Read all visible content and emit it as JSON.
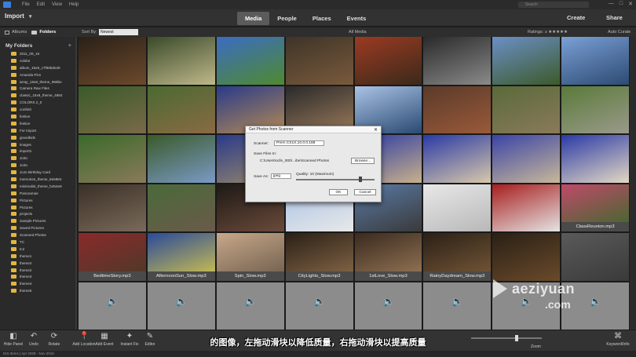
{
  "menu": [
    "File",
    "Edit",
    "View",
    "Help"
  ],
  "search_placeholder": "Search",
  "window_buttons": [
    "—",
    "□",
    "✕"
  ],
  "topbar": {
    "import": "Import",
    "tabs": [
      "Media",
      "People",
      "Places",
      "Events"
    ],
    "active_tab": "Media",
    "create": "Create",
    "share": "Share"
  },
  "view_toggle": {
    "albums": "Albums",
    "folders": "Folders"
  },
  "sortbar": {
    "sort_label": "Sort By:",
    "sort_value": "Newest",
    "all_media": "All Media",
    "ratings": "Ratings: ≥ ★★★★★",
    "auto_curate": "Auto Curate"
  },
  "sidebar": {
    "header": "My Folders",
    "folders": [
      "2011_09_16",
      "Adobe",
      "album_16x9_c7f96bde29",
      "Amanda Pics",
      "array_16x9_theme_968be",
      "Camera Raw Files",
      "classic_16x9_theme_4884",
      "COLORS 2_0",
      "confetti",
      "festive",
      "festive",
      "For Import",
      "grandkids",
      "images",
      "import1",
      "Jo3o",
      "Jo3o",
      "JoJo Birthday Card",
      "memories_theme_8e5984",
      "minimalist_theme_b454e8",
      "Panoramas",
      "Pictures",
      "Pictures",
      "projects",
      "Sample Pictures",
      "Saved Pictures",
      "Scanned Photos",
      "TC",
      "tc2",
      "theme1",
      "theme2",
      "theme2",
      "theme3",
      "theme4",
      "theme5"
    ]
  },
  "grid": {
    "cells": [
      {
        "c1": "#2a2018",
        "c2": "#6d4a2c"
      },
      {
        "c1": "#3a4a2a",
        "c2": "#bfb88a"
      },
      {
        "c1": "#3b6cc2",
        "c2": "#4f8a2e"
      },
      {
        "c1": "#3e3428",
        "c2": "#7a5a3c"
      },
      {
        "c1": "#9c3a22",
        "c2": "#3a2a1a"
      },
      {
        "c1": "#2a2a2a",
        "c2": "#8a8a8a"
      },
      {
        "c1": "#6b8fc6",
        "c2": "#3c5a2a"
      },
      {
        "c1": "#7aa0d6",
        "c2": "#2d4a72"
      },
      {
        "c1": "#3a5a2a",
        "c2": "#7a6a4a"
      },
      {
        "c1": "#4a6a32",
        "c2": "#8a6a44"
      },
      {
        "c1": "#2a3a8a",
        "c2": "#b28a54"
      },
      {
        "c1": "#2a2a2a",
        "c2": "#9a7a5a"
      },
      {
        "c1": "#aac3e6",
        "c2": "#2a4a72"
      },
      {
        "c1": "#5a3a2a",
        "c2": "#9a5a3a"
      },
      {
        "c1": "#5a6a3a",
        "c2": "#8a7a5a"
      },
      {
        "c1": "#5a7a3a",
        "c2": "#9a9a8a"
      },
      {
        "c1": "#3a6a2a",
        "c2": "#8a7a5a"
      },
      {
        "c1": "#3a5a2a",
        "c2": "#7a9ac6"
      },
      {
        "c1": "#2a3a8a",
        "c2": "#9a8a6a"
      },
      {
        "c1": "#e0e0e0",
        "c2": "#b6b6b6"
      },
      {
        "c1": "#2a3aa6",
        "c2": "#c8b08a"
      },
      {
        "c1": "#2a3aa6",
        "c2": "#d8c8aa"
      },
      {
        "c1": "#3a44a6",
        "c2": "#c8b89a"
      },
      {
        "c1": "#2a3aa6",
        "c2": "#e4d8c4"
      },
      {
        "c1": "#3a3026",
        "c2": "#7a6a5a"
      },
      {
        "c1": "#4a6a3a",
        "c2": "#6a5a4a"
      },
      {
        "c1": "#1e1a16",
        "c2": "#6a4a3a"
      },
      {
        "c1": "#aac3e6",
        "c2": "#e8e8e8"
      },
      {
        "c1": "#5a7aa6",
        "c2": "#3a3a3a"
      },
      {
        "c1": "#e8e8e8",
        "c2": "#b8b8b8"
      },
      {
        "c1": "#a81e1e",
        "c2": "#e4e4e4"
      },
      {
        "c1": "#c04a6a",
        "c2": "#3a6a2a"
      },
      {
        "c1": "#8a2a2a",
        "c2": "#4a3a2a"
      },
      {
        "c1": "#2a4a9a",
        "c2": "#d8c84a"
      },
      {
        "c1": "#c8a88a",
        "c2": "#6a5a4a"
      },
      {
        "c1": "#2a2016",
        "c2": "#8a6a4a"
      },
      {
        "c1": "#3a2a1e",
        "c2": "#9a7a5a"
      },
      {
        "c1": "#2a2016",
        "c2": "#7a5a3a"
      },
      {
        "c1": "#2a2016",
        "c2": "#6a4a2a"
      },
      {
        "c1": "#5a5a5a",
        "c2": "#3a3a3a"
      },
      {
        "audio": true
      },
      {
        "audio": true
      },
      {
        "audio": true
      },
      {
        "audio": true
      },
      {
        "audio": true
      },
      {
        "audio": true
      },
      {
        "audio": true
      },
      {
        "audio": true
      }
    ],
    "captions": {
      "31": "ClassReunion.mp3",
      "32": "BedtimeStory.mp3",
      "33": "AfternoonSun_Slow.mp3",
      "34": "Spin_Slow.mp3",
      "35": "CityLights_Slow.mp3",
      "36": "1stLove_Slow.mp3",
      "37": "RainyDaydream_Slow.mp3"
    }
  },
  "dialog": {
    "title": "Get Photos from Scanner",
    "scanner_label": "Scanner:",
    "scanner_value": "Prem CS1X,10.0.0.188",
    "save_in_label": "Save Files In:",
    "save_in_value": "C:\\Users\\ocfe_000\\...ibe\\Scanned Photos",
    "browse": "Browse...",
    "save_as_label": "Save As:",
    "save_as_value": "jpeg",
    "quality_label": "Quality: 10 (Maximum)",
    "quality_value": 10,
    "ok": "OK",
    "cancel": "Cancel"
  },
  "toolbar": {
    "tools": [
      {
        "label": "Hide Panel",
        "icon": "◧"
      },
      {
        "label": "Undo",
        "icon": "↶"
      },
      {
        "label": "Rotate",
        "icon": "⟳"
      },
      {
        "label": "Add Location",
        "icon": "📍"
      },
      {
        "label": "Add Event",
        "icon": "▦"
      },
      {
        "label": "Instant Fix",
        "icon": "✦"
      },
      {
        "label": "Editor",
        "icon": "✎"
      }
    ],
    "zoom": "Zoom",
    "zoom_level": 0.65,
    "keyword_info": "Keyword/Info"
  },
  "status": "515 Items  |  Apr 2008 - Nov 2016",
  "subtitle": "的图像，左拖动滑块以降低质量，右拖动滑块以提高质量",
  "watermark": "aeziyuan",
  "watermark_domain": ".com"
}
